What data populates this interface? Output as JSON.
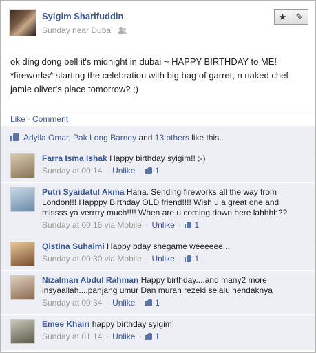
{
  "post": {
    "author": "Syigim Sharifuddin",
    "meta": "Sunday near Dubai",
    "star_icon": "★",
    "edit_icon": "✎",
    "text": "ok ding dong bell it's midnight in dubai ~ HAPPY BIRTHDAY to ME! *fireworks* starting the celebration with big bag of garret, n naked chef jamie oliver's place tomorrow? ;)"
  },
  "actions": {
    "like": "Like",
    "dot": "·",
    "comment": "Comment"
  },
  "likes": {
    "person1": "Adylla Omar",
    "comma": ", ",
    "person2": "Pak Long Barney",
    "and": " and ",
    "others": "13 others",
    "suffix": " like this."
  },
  "comments": [
    {
      "name": "Farra Isma Ishak",
      "text": " Happy birthday syigim!! ;-)",
      "time": "Sunday at 00:14",
      "unlike": "Unlike",
      "likes": "1",
      "avatar_color": "#a89478"
    },
    {
      "name": "Putri Syaidatul Akma",
      "text": " Haha. Sending fireworks all the way from London!!! Happpy Birthday OLD friend!!!! Wish u a great one and missss ya verrrry much!!!! When are u coming down here lahhhh??",
      "time": "Sunday at 00:15 via Mobile",
      "unlike": "Unlike",
      "likes": "1",
      "avatar_color": "#8fb0c8"
    },
    {
      "name": "Qistina Suhaimi",
      "text": " Happy bday shegame weeeeee....",
      "time": "Sunday at 00:30 via Mobile",
      "unlike": "Unlike",
      "likes": "1",
      "avatar_color": "#c09a70"
    },
    {
      "name": "Nizalman Abdul Rahman",
      "text": " Happy birthday....and many2 more insyaallah....panjang umur Dan murah rezeki selalu hendaknya",
      "time": "Sunday at 00:34",
      "unlike": "Unlike",
      "likes": "1",
      "avatar_color": "#b8a088"
    },
    {
      "name": "Emee Khairi",
      "text": " happy birthday syigim!",
      "time": "Sunday at 01:14",
      "unlike": "Unlike",
      "likes": "1",
      "avatar_color": "#9a9a8a"
    }
  ],
  "meta_sep": " · "
}
